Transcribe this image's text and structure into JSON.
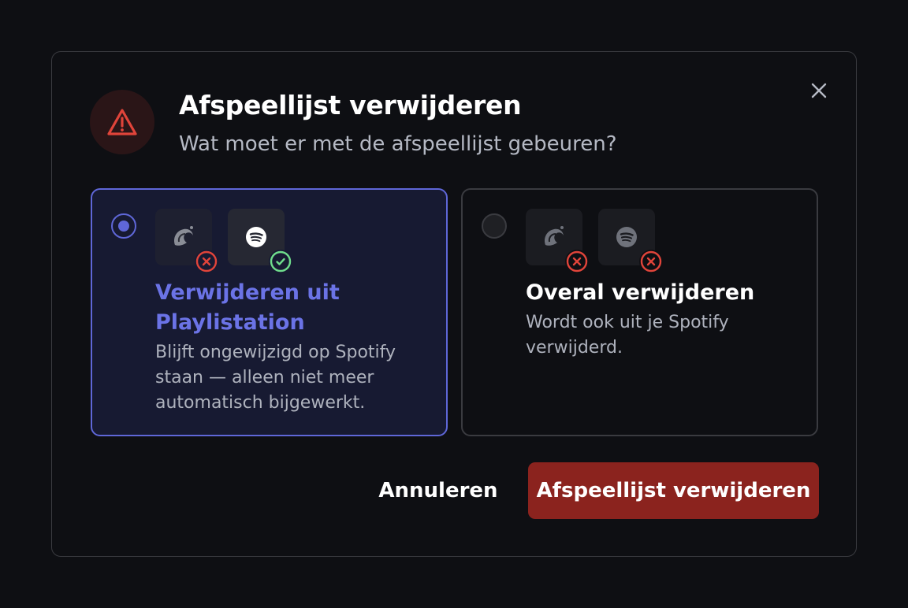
{
  "dialog": {
    "title": "Afspeellijst verwijderen",
    "subtitle": "Wat moet er met de afspeellijst gebeuren?",
    "icons": {
      "header": "warning-triangle-icon",
      "close": "close-icon"
    },
    "colors": {
      "danger": "#e0443a",
      "accent": "#5f67d8",
      "success": "#6fdc8c",
      "delete_button": "#8b231e"
    }
  },
  "options": [
    {
      "title": "Verwijderen uit Playlistation",
      "description": "Blijft ongewijzigd op Spotify staan — alleen niet meer automatisch bijgewerkt.",
      "selected": true,
      "apps": [
        {
          "icon": "playlistation-logo-icon",
          "status": "removed",
          "status_icon": "x-circle-icon"
        },
        {
          "icon": "spotify-logo-icon",
          "status": "kept",
          "status_icon": "check-circle-icon"
        }
      ]
    },
    {
      "title": "Overal verwijderen",
      "description": "Wordt ook uit je Spotify verwijderd.",
      "selected": false,
      "apps": [
        {
          "icon": "playlistation-logo-icon",
          "status": "removed",
          "status_icon": "x-circle-icon"
        },
        {
          "icon": "spotify-logo-icon",
          "status": "removed",
          "status_icon": "x-circle-icon"
        }
      ]
    }
  ],
  "actions": {
    "cancel_label": "Annuleren",
    "confirm_label": "Afspeellijst verwijderen"
  }
}
